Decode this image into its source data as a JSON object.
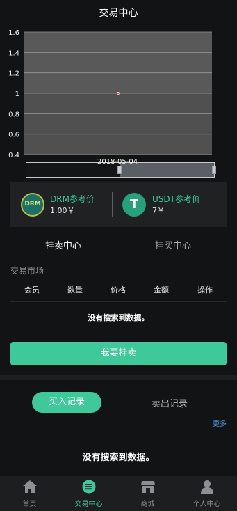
{
  "header": {
    "title": "交易中心"
  },
  "chart_data": {
    "type": "line",
    "x": [
      "2018-05-04"
    ],
    "series": [
      {
        "values": [
          1
        ]
      }
    ],
    "y_ticks": [
      "1.6",
      "1.4",
      "1.2",
      "1",
      "0.8",
      "0.6",
      "0.4"
    ],
    "ylim": [
      0.4,
      1.6
    ],
    "grid": true,
    "slider_date": "2018-05-04"
  },
  "prices": [
    {
      "coin_icon": "DRM",
      "name": "DRM参考价",
      "value": "1.00￥"
    },
    {
      "coin_icon": "T",
      "name": "USDT参考价",
      "value": "7￥"
    }
  ],
  "tabs": [
    {
      "label": "挂卖中心",
      "active": true
    },
    {
      "label": "挂买中心",
      "active": false
    }
  ],
  "market": {
    "title": "交易市场",
    "columns": [
      "会员",
      "数量",
      "价格",
      "金额",
      "操作"
    ],
    "empty": "没有搜索到数据。"
  },
  "sell_button": "我要挂卖",
  "records": {
    "buy_tab": "买入记录",
    "sell_tab": "卖出记录",
    "more": "更多",
    "empty": "没有搜索到数据。"
  },
  "nav": [
    {
      "label": "首页",
      "icon": "home-icon",
      "active": false
    },
    {
      "label": "交易中心",
      "icon": "exchange-icon",
      "active": true
    },
    {
      "label": "商城",
      "icon": "store-icon",
      "active": false
    },
    {
      "label": "个人中心",
      "icon": "user-icon",
      "active": false
    }
  ],
  "colors": {
    "accent": "#3fc89a",
    "background": "#121314",
    "link": "#4b9be6"
  }
}
